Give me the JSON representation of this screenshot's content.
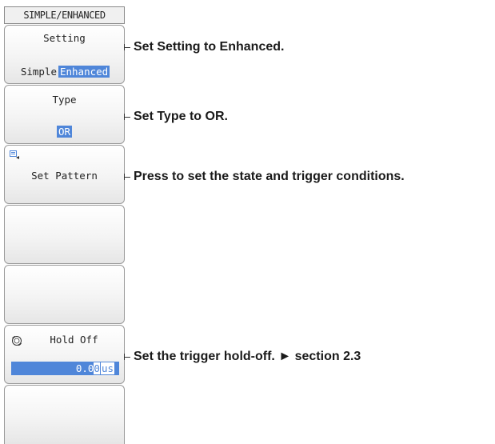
{
  "menu": {
    "title": "SIMPLE/ENHANCED"
  },
  "softkeys": {
    "setting": {
      "title": "Setting",
      "options": [
        "Simple",
        "Enhanced"
      ],
      "selected": "Enhanced"
    },
    "type": {
      "title": "Type",
      "value": "OR"
    },
    "set_pattern": {
      "label": "Set Pattern",
      "icon": "menu-submenu-icon"
    },
    "hold_off": {
      "title": "Hold Off",
      "icon": "rotary-knob-icon",
      "value_main": "0.0",
      "value_cursor": "0",
      "unit": "us"
    }
  },
  "annotations": {
    "setting": "Set Setting to Enhanced.",
    "type": "Set Type to OR.",
    "set_pattern": "Press to set the state and trigger conditions.",
    "hold_off": "Set the trigger hold-off. ► section 2.3"
  },
  "colors": {
    "highlight": "#4f86d9",
    "border": "#9a9a9a"
  }
}
